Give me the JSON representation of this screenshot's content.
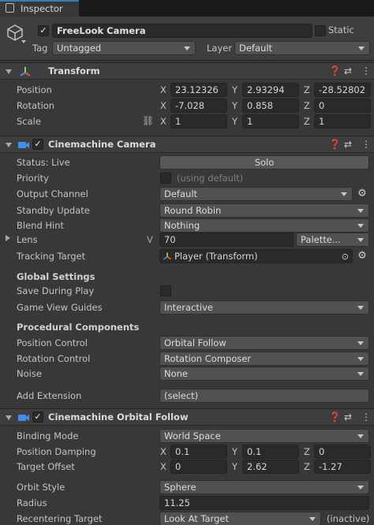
{
  "tab": {
    "title": "Inspector"
  },
  "object": {
    "name": "FreeLook Camera",
    "static_label": "Static",
    "tag_label": "Tag",
    "tag_value": "Untagged",
    "layer_label": "Layer",
    "layer_value": "Default"
  },
  "transform": {
    "title": "Transform",
    "position": {
      "label": "Position",
      "x": "23.12326",
      "y": "2.93294",
      "z": "-28.52802"
    },
    "rotation": {
      "label": "Rotation",
      "x": "-7.028",
      "y": "0.858",
      "z": "0"
    },
    "scale": {
      "label": "Scale",
      "x": "1",
      "y": "1",
      "z": "1"
    },
    "axes": {
      "x": "X",
      "y": "Y",
      "z": "Z"
    }
  },
  "cinemachine_camera": {
    "title": "Cinemachine Camera",
    "status_label": "Status: Live",
    "solo_label": "Solo",
    "priority_label": "Priority",
    "priority_hint": "(using default)",
    "output_channel_label": "Output Channel",
    "output_channel_value": "Default",
    "standby_update_label": "Standby Update",
    "standby_update_value": "Round Robin",
    "blend_hint_label": "Blend Hint",
    "blend_hint_value": "Nothing",
    "lens_label": "Lens",
    "lens_v": "V",
    "lens_value": "70",
    "lens_palette": "Palette...",
    "tracking_target_label": "Tracking Target",
    "tracking_target_value": "Player (Transform)",
    "global_settings_heading": "Global Settings",
    "save_during_play_label": "Save During Play",
    "game_view_guides_label": "Game View Guides",
    "game_view_guides_value": "Interactive",
    "procedural_heading": "Procedural Components",
    "position_control_label": "Position Control",
    "position_control_value": "Orbital Follow",
    "rotation_control_label": "Rotation Control",
    "rotation_control_value": "Rotation Composer",
    "noise_label": "Noise",
    "noise_value": "None",
    "add_extension_label": "Add Extension",
    "add_extension_value": "(select)"
  },
  "orbital_follow": {
    "title": "Cinemachine Orbital Follow",
    "binding_mode_label": "Binding Mode",
    "binding_mode_value": "World Space",
    "position_damping": {
      "label": "Position Damping",
      "x": "0.1",
      "y": "0.1",
      "z": "0"
    },
    "target_offset": {
      "label": "Target Offset",
      "x": "0",
      "y": "2.62",
      "z": "-1.27"
    },
    "orbit_style_label": "Orbit Style",
    "orbit_style_value": "Sphere",
    "radius_label": "Radius",
    "radius_value": "11.25",
    "recentering_target_label": "Recentering Target",
    "recentering_target_value": "Look At Target",
    "recentering_state": "(inactive)"
  },
  "colors": {
    "background": "#383838",
    "header": "#3e3e3e",
    "field": "#2a2a2a",
    "dropdown": "#515151",
    "axis_x": "#e0553d",
    "axis_y": "#8fd14f",
    "axis_z": "#3f8ee8"
  },
  "icons": [
    "inspector-icon",
    "cube-icon",
    "transform-icon",
    "cinemachine-icon",
    "help-icon",
    "preset-icon",
    "kebab-menu-icon",
    "gear-icon",
    "link-icon",
    "target-icon"
  ]
}
